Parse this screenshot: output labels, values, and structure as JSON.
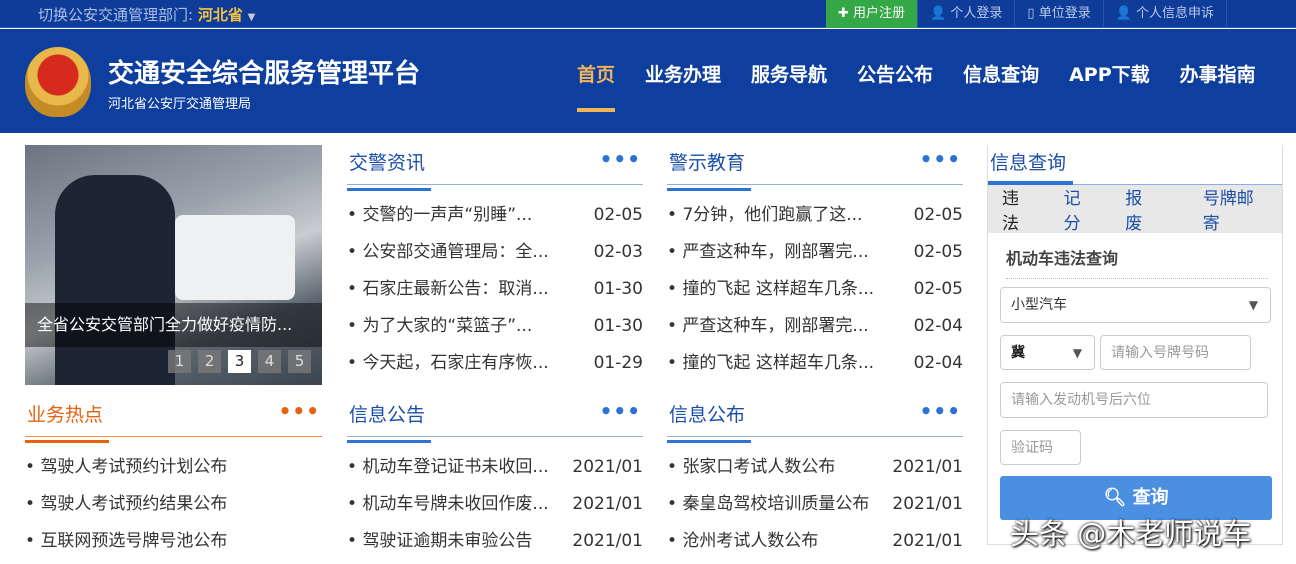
{
  "topbar": {
    "switch_label": "切换公安交通管理部门:",
    "region": "河北省",
    "register": "用户注册",
    "personal_login": "个人登录",
    "unit_login": "单位登录",
    "appeal": "个人信息申诉"
  },
  "header": {
    "title": "交通安全综合服务管理平台",
    "subtitle": "河北省公安厅交通管理局",
    "nav": [
      "首页",
      "业务办理",
      "服务导航",
      "公告公布",
      "信息查询",
      "APP下载",
      "办事指南"
    ]
  },
  "carousel": {
    "caption": "全省公安交管部门全力做好疫情防...",
    "pages": [
      "1",
      "2",
      "3",
      "4",
      "5"
    ],
    "active": 3
  },
  "sections": {
    "jjzx": {
      "title": "交警资讯",
      "more": "•••",
      "items": [
        {
          "t": "交警的一声声“别睡”...",
          "d": "02-05"
        },
        {
          "t": "公安部交通管理局：全...",
          "d": "02-03"
        },
        {
          "t": "石家庄最新公告：取消...",
          "d": "01-30"
        },
        {
          "t": "为了大家的“菜篮子”...",
          "d": "01-30"
        },
        {
          "t": "今天起，石家庄有序恢...",
          "d": "01-29"
        }
      ]
    },
    "jsjy": {
      "title": "警示教育",
      "more": "•••",
      "items": [
        {
          "t": "7分钟，他们跑赢了这...",
          "d": "02-05"
        },
        {
          "t": "严查这种车，刚部署完...",
          "d": "02-05"
        },
        {
          "t": "撞的飞起 这样超车几条...",
          "d": "02-05"
        },
        {
          "t": "严查这种车，刚部署完...",
          "d": "02-04"
        },
        {
          "t": "撞的飞起 这样超车几条...",
          "d": "02-04"
        }
      ]
    },
    "ywrd": {
      "title": "业务热点",
      "more": "•••",
      "items": [
        {
          "t": "驾驶人考试预约计划公布"
        },
        {
          "t": "驾驶人考试预约结果公布"
        },
        {
          "t": "互联网预选号牌号池公布"
        }
      ]
    },
    "xxgg": {
      "title": "信息公告",
      "more": "•••",
      "items": [
        {
          "t": "机动车登记证书未收回...",
          "d": "2021/01"
        },
        {
          "t": "机动车号牌未收回作废...",
          "d": "2021/01"
        },
        {
          "t": "驾驶证逾期未审验公告",
          "d": "2021/01"
        }
      ]
    },
    "xxgb": {
      "title": "信息公布",
      "more": "•••",
      "items": [
        {
          "t": "张家口考试人数公布",
          "d": "2021/01"
        },
        {
          "t": "秦皇岛驾校培训质量公布",
          "d": "2021/01"
        },
        {
          "t": "沧州考试人数公布",
          "d": "2021/01"
        }
      ]
    }
  },
  "query": {
    "title": "信息查询",
    "tabs": [
      "违法",
      "记分",
      "报废",
      "号牌邮寄"
    ],
    "form_title": "机动车违法查询",
    "vehicle_type": "小型汽车",
    "province": "冀",
    "plate_placeholder": "请输入号牌号码",
    "engine_placeholder": "请输入发动机号后六位",
    "captcha_placeholder": "验证码",
    "submit": "查询"
  },
  "watermark": "头条 @木老师说车"
}
